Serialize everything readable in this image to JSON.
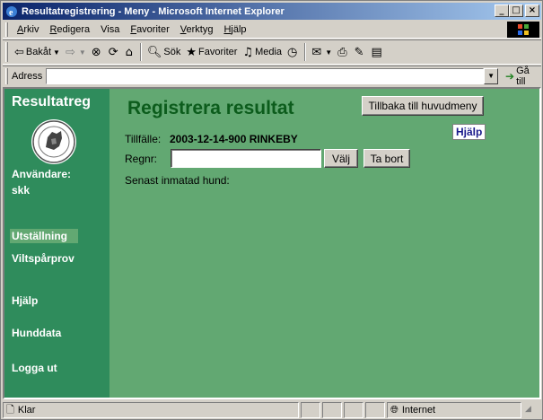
{
  "window": {
    "title": "Resultatregistrering - Meny - Microsoft Internet Explorer",
    "minimize": "_",
    "maximize": "□",
    "close": "×"
  },
  "menu": {
    "items": [
      {
        "key": "A",
        "rest": "rkiv"
      },
      {
        "key": "R",
        "rest": "edigera"
      },
      {
        "key": "Vi",
        "rest": "sa",
        "underline_index": 1
      },
      {
        "key": "F",
        "rest": "avoriter"
      },
      {
        "key": "V",
        "rest": "erktyg"
      },
      {
        "key": "H",
        "rest": "jälp"
      }
    ]
  },
  "toolbar": {
    "back": "Bakåt",
    "search": "Sök",
    "favorites": "Favoriter",
    "media": "Media"
  },
  "address": {
    "label": "Adress",
    "value": "",
    "go": "Gå till"
  },
  "sidebar": {
    "brand": "Resultatreg",
    "user_label": "Användare:",
    "user_name": "skk",
    "nav": [
      {
        "label": "Utställning",
        "active": true
      },
      {
        "label": "Viltspårprov",
        "active": false
      },
      {
        "label": "Hjälp",
        "active": false
      },
      {
        "label": "Hunddata",
        "active": false
      },
      {
        "label": "Logga ut",
        "active": false
      }
    ]
  },
  "main": {
    "title": "Registrera resultat",
    "back_button": "Tillbaka till huvudmeny",
    "help": "Hjälp",
    "occasion_label": "Tillfälle:",
    "occasion_value": "2003-12-14-900 RINKEBY",
    "regnr_label": "Regnr:",
    "regnr_value": "",
    "select_button": "Välj",
    "remove_button": "Ta bort",
    "last_entered": "Senast inmatad hund:"
  },
  "status": {
    "text": "Klar",
    "zone": "Internet"
  },
  "colors": {
    "sidebar": "#2f8c5c",
    "content": "#62a872",
    "title": "#0c5c1c"
  }
}
